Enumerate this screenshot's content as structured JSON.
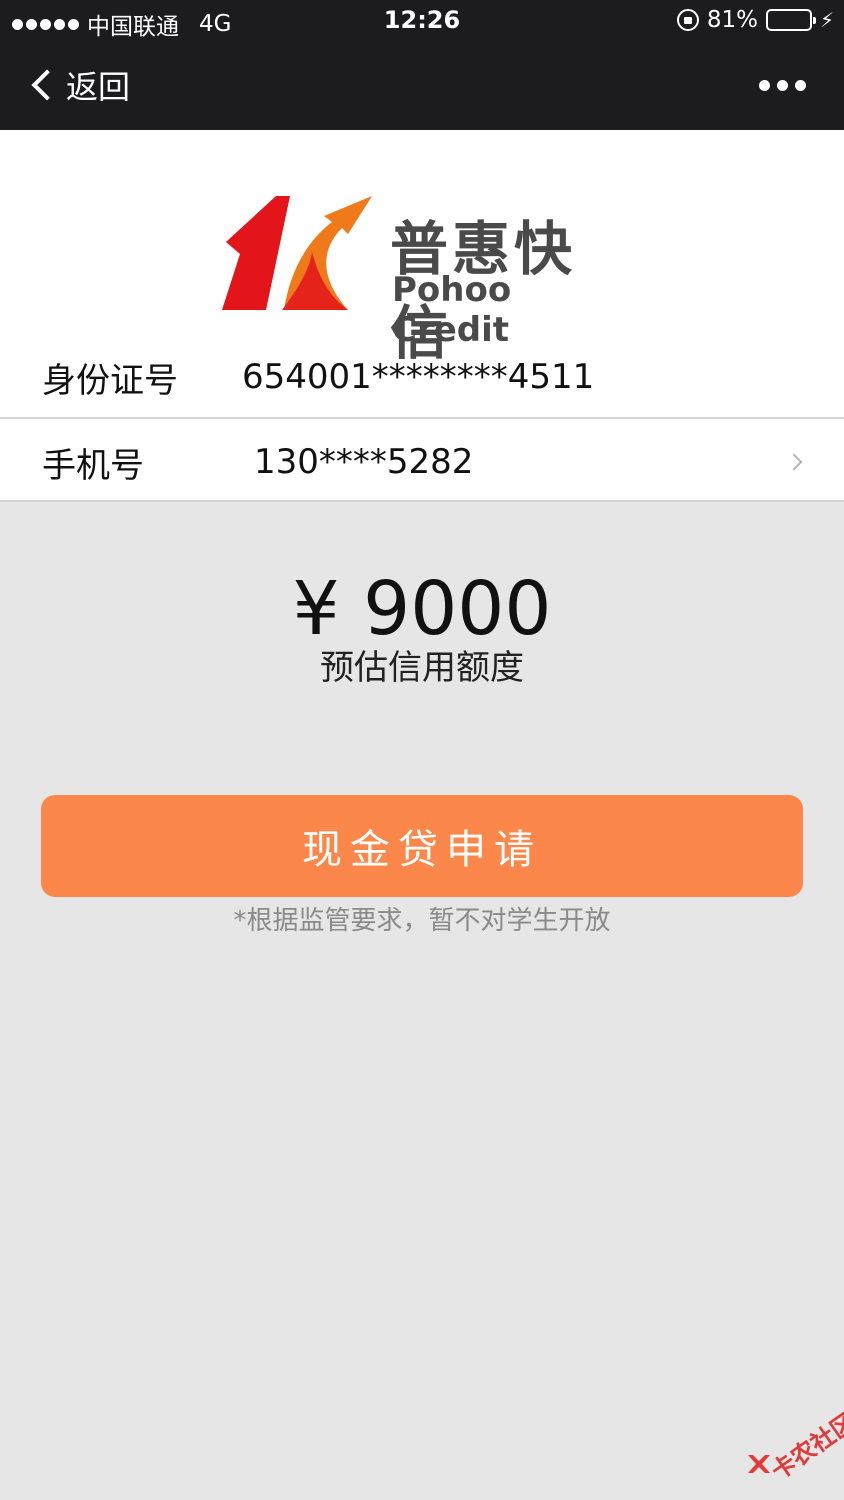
{
  "status_bar": {
    "carrier": "中国联通",
    "network": "4G",
    "time": "12:26",
    "battery_percent": "81%",
    "battery_level": 0.81
  },
  "nav": {
    "back_label": "返回"
  },
  "brand": {
    "name_cn": "普惠快信",
    "name_en": "Pohoo Credit"
  },
  "form": {
    "id_label": "身份证号",
    "id_value": "654001********4511",
    "phone_label": "手机号",
    "phone_value": "130****5282"
  },
  "credit": {
    "amount": "¥ 9000",
    "label": "预估信用额度"
  },
  "apply_button": "现金贷申请",
  "notice": "*根据监管要求，暂不对学生开放",
  "watermark": "卡农社区",
  "colors": {
    "nav_bg": "#1c1c1e",
    "button": "#fb884a",
    "battery": "#4cd964",
    "logo_red": "#e4141b",
    "logo_orange": "#f07a1a"
  }
}
